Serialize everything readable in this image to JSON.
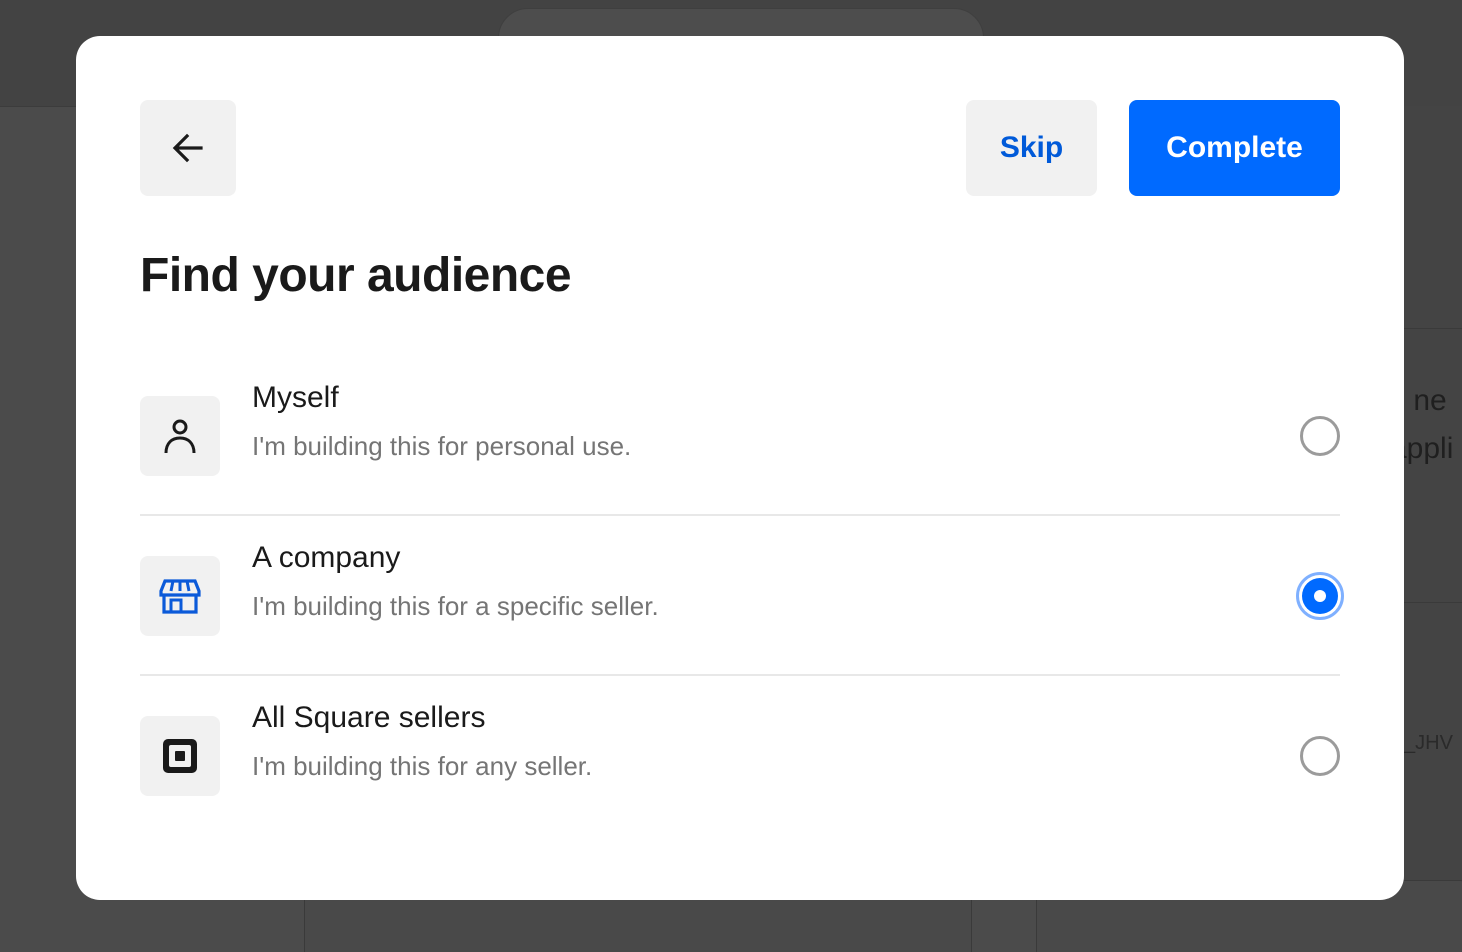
{
  "background": {
    "right_text_1": "s ne",
    "right_text_2": "appli",
    "right_text_3": "_JHV"
  },
  "modal": {
    "title": "Find your audience",
    "skip_label": "Skip",
    "complete_label": "Complete",
    "options": [
      {
        "label": "Myself",
        "description": "I'm building this for personal use.",
        "icon": "person-icon",
        "selected": false
      },
      {
        "label": "A company",
        "description": "I'm building this for a specific seller.",
        "icon": "storefront-icon",
        "selected": true
      },
      {
        "label": "All Square sellers",
        "description": "I'm building this for any seller.",
        "icon": "square-logo-icon",
        "selected": false
      }
    ]
  },
  "colors": {
    "accent": "#006aff",
    "skip_text": "#005ad9",
    "store_icon": "#0b5ad9",
    "radio_ring": "#7fb0ff"
  }
}
